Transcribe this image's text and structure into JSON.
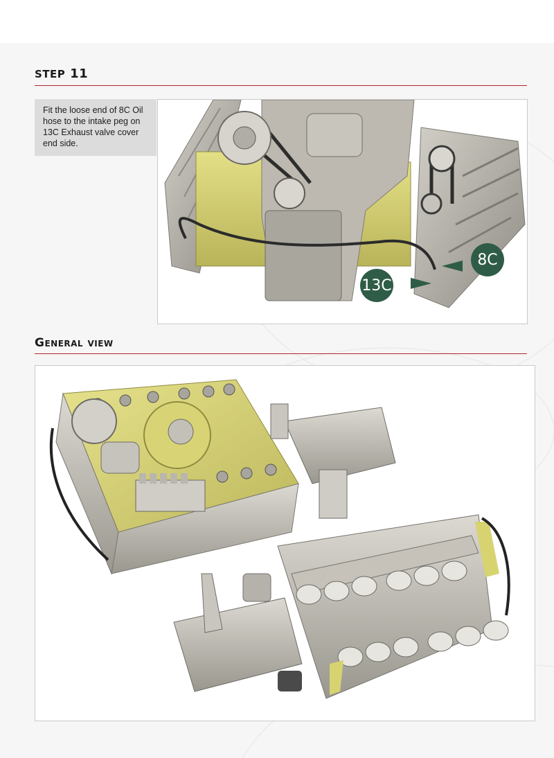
{
  "step": {
    "word": "STEP",
    "number": "11"
  },
  "instruction": "Fit the loose end of 8C Oil hose to the intake peg on 13C Exhaust valve cover end side.",
  "callouts": [
    {
      "id": "8C",
      "label": "8C"
    },
    {
      "id": "13C",
      "label": "13C"
    }
  ],
  "general_view": {
    "title": "General view"
  },
  "colors": {
    "accent_rule": "#b3262b",
    "callout_green": "#2f5c46",
    "engine_yellow": "#d9d56e",
    "metal_grey": "#b9b6ae"
  }
}
